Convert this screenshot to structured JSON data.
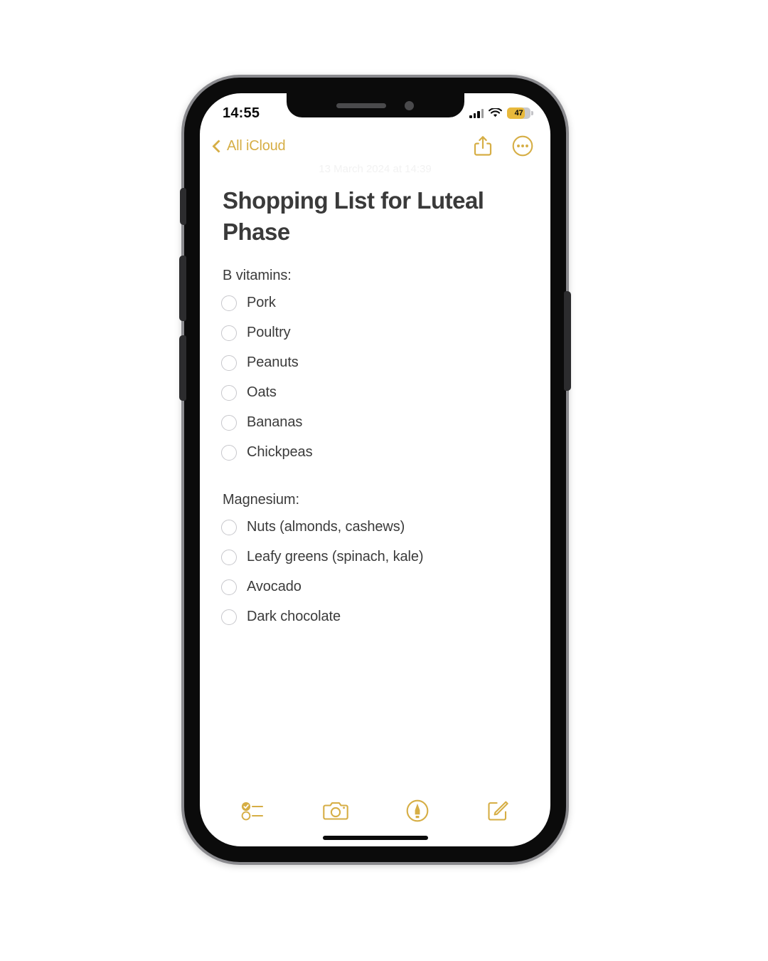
{
  "status_bar": {
    "time": "14:55",
    "battery_level": "47",
    "battery_percent": 47,
    "wifi_icon": "wifi-icon",
    "cellular_icon": "cellular-signal-icon",
    "battery_icon": "battery-icon",
    "battery_color": "#e8b93c"
  },
  "nav": {
    "back_label": "All iCloud",
    "back_icon": "chevron-left-icon",
    "share_icon": "share-icon",
    "more_icon": "more-ellipsis-icon",
    "accent_color": "#d6ae45"
  },
  "note": {
    "date": "13 March 2024 at 14:39",
    "title": "Shopping List for Luteal Phase",
    "sections": [
      {
        "heading": "B vitamins:",
        "items": [
          {
            "label": "Pork",
            "checked": false
          },
          {
            "label": "Poultry",
            "checked": false
          },
          {
            "label": "Peanuts",
            "checked": false
          },
          {
            "label": "Oats",
            "checked": false
          },
          {
            "label": "Bananas",
            "checked": false
          },
          {
            "label": "Chickpeas",
            "checked": false
          }
        ]
      },
      {
        "heading": "Magnesium:",
        "items": [
          {
            "label": "Nuts (almonds, cashews)",
            "checked": false
          },
          {
            "label": "Leafy greens (spinach, kale)",
            "checked": false
          },
          {
            "label": "Avocado",
            "checked": false
          },
          {
            "label": "Dark chocolate",
            "checked": false
          }
        ]
      }
    ]
  },
  "toolbar": {
    "checklist_icon": "checklist-icon",
    "camera_icon": "camera-icon",
    "markup_icon": "markup-pen-icon",
    "compose_icon": "compose-icon"
  }
}
